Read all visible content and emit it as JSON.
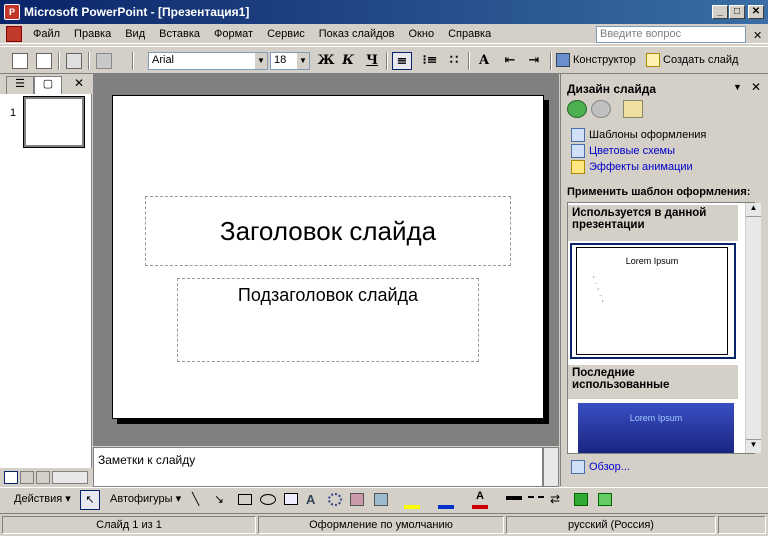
{
  "window": {
    "title": "Microsoft PowerPoint - [Презентация1]",
    "min_label": "_",
    "max_label": "□",
    "close_label": "✕",
    "doc_close_label": "✕"
  },
  "menu": [
    "Файл",
    "Правка",
    "Вид",
    "Вставка",
    "Формат",
    "Сервис",
    "Показ слайдов",
    "Окно",
    "Справка"
  ],
  "help_placeholder": "Введите вопрос",
  "toolbar": {
    "font": "Arial",
    "font_size": "18",
    "bold": "Ж",
    "italic": "К",
    "underline": "Ч",
    "designer_label": "Конструктор",
    "new_slide_label": "Создать слайд"
  },
  "left_panel": {
    "slide_number": "1"
  },
  "slide": {
    "title": "Заголовок слайда",
    "subtitle": "Подзаголовок слайда"
  },
  "notes_placeholder": "Заметки к слайду",
  "task_pane": {
    "title": "Дизайн слайда",
    "links": [
      "Шаблоны оформления",
      "Цветовые схемы",
      "Эффекты анимации"
    ],
    "apply_label": "Применить шаблон оформления:",
    "group_used": "Используется в данной презентации",
    "group_recent": "Последние использованные",
    "thumb_title": "Lorem Ipsum",
    "browse_label": "Обзор..."
  },
  "drawing": {
    "actions_label": "Действия",
    "autoshapes_label": "Автофигуры"
  },
  "status": {
    "slide": "Слайд 1 из 1",
    "design": "Оформление по умолчанию",
    "language": "русский (Россия)"
  }
}
